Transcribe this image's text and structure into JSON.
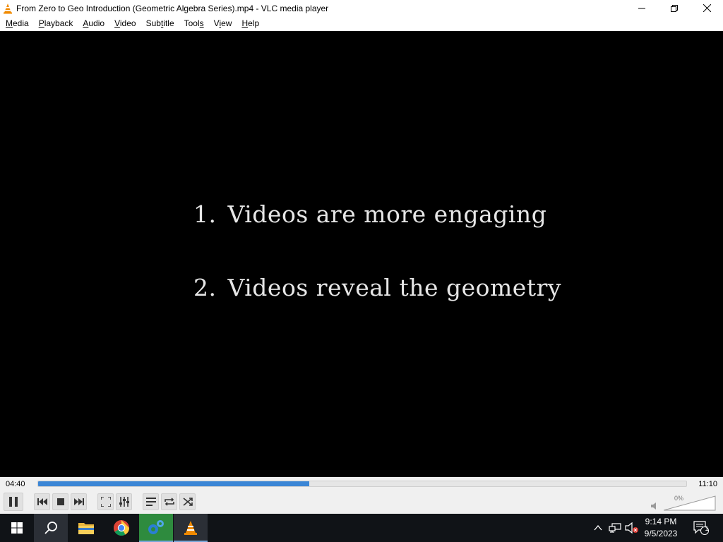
{
  "window": {
    "title": "From Zero to Geo Introduction (Geometric Algebra Series).mp4 - VLC media player",
    "app_icon": "vlc-cone-icon",
    "buttons": [
      "minimize-icon",
      "restore-icon",
      "close-icon"
    ]
  },
  "menu": {
    "items": [
      {
        "label": "Media",
        "accel": "M"
      },
      {
        "label": "Playback",
        "accel": "P"
      },
      {
        "label": "Audio",
        "accel": "A"
      },
      {
        "label": "Video",
        "accel": "V"
      },
      {
        "label": "Subtitle",
        "accel": "t"
      },
      {
        "label": "Tools",
        "accel": "s"
      },
      {
        "label": "View",
        "accel": "i"
      },
      {
        "label": "Help",
        "accel": "H"
      }
    ]
  },
  "video": {
    "lines": [
      {
        "num": "1.",
        "text": "Videos are more engaging"
      },
      {
        "num": "2.",
        "text": "Videos reveal the geometry"
      }
    ]
  },
  "playback": {
    "elapsed": "04:40",
    "total": "11:10",
    "progress": 0.418,
    "accent": "#3b86d6"
  },
  "controls": {
    "buttons": [
      "pause-icon",
      "previous-icon",
      "stop-icon",
      "next-icon",
      "fullscreen-icon",
      "extended-settings-icon",
      "playlist-icon",
      "loop-icon",
      "shuffle-icon"
    ]
  },
  "volume": {
    "label": "0%",
    "level": 0
  },
  "taskbar": {
    "apps": [
      "windows-start-icon",
      "search-icon",
      "file-explorer-icon",
      "chrome-icon",
      "gear-app-icon",
      "vlc-cone-icon"
    ],
    "tray": [
      "chevron-up-icon",
      "network-icon",
      "speaker-muted-icon",
      "notification-icon"
    ],
    "time": "9:14 PM",
    "date": "9/5/2023",
    "notification_count": "1"
  }
}
